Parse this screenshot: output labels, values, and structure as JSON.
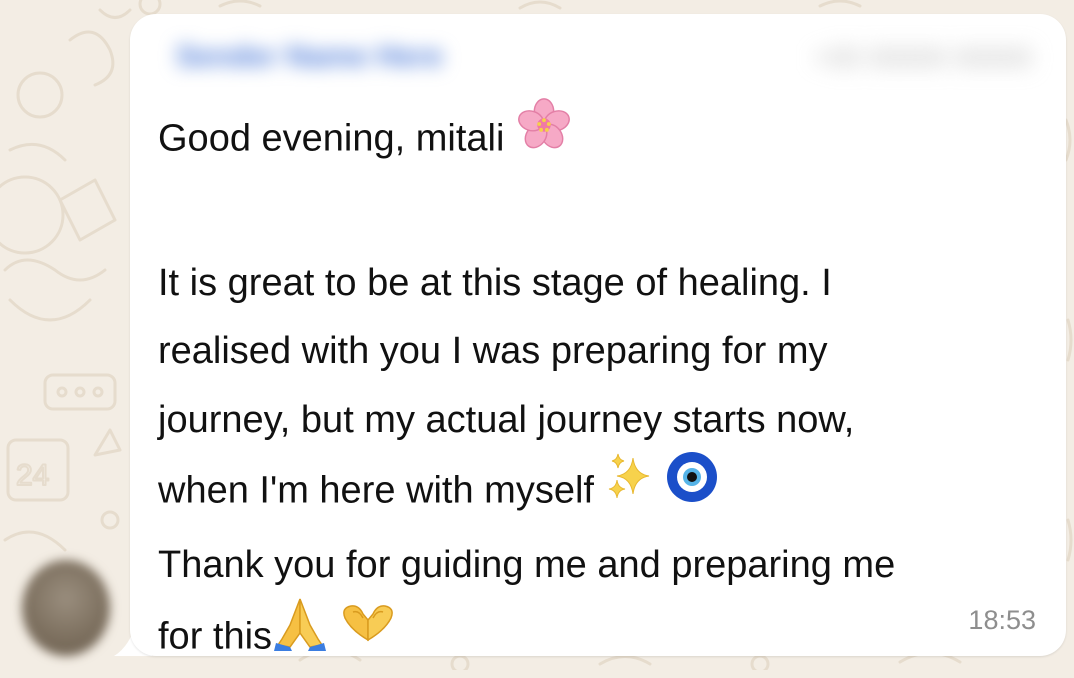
{
  "message": {
    "greeting": "Good evening, mitali",
    "lines": [
      "It is great to be at this stage of healing. I",
      "realised with you I was preparing for my",
      "journey, but my actual journey starts now,",
      "when I'm here with myself",
      "Thank you for guiding me and preparing me",
      "for this"
    ],
    "timestamp": "18:53"
  },
  "icons": {
    "greeting_emoji": "cherry-blossom-icon",
    "sparkles": "sparkles-icon",
    "evil_eye": "nazar-amulet-icon",
    "folded_hands": "folded-hands-icon",
    "heart_hands": "heart-hands-icon"
  },
  "colors": {
    "background": "#f3ede4",
    "bubble": "#ffffff",
    "text": "#111111",
    "timestamp": "#8e8e8e",
    "sender_name": "#4a79d8"
  }
}
